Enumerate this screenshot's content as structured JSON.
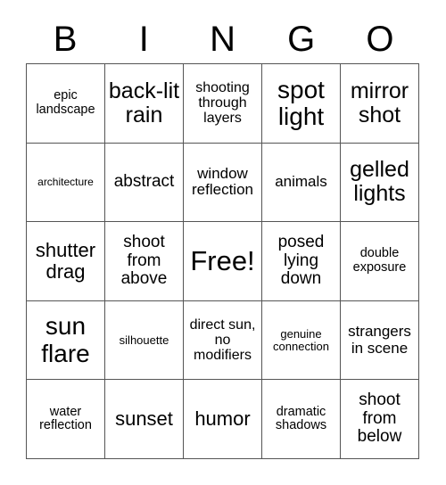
{
  "header": {
    "letters": [
      "B",
      "I",
      "N",
      "G",
      "O"
    ]
  },
  "grid": {
    "rows": [
      [
        {
          "text": "epic landscape",
          "size": "fs-s"
        },
        {
          "text": "back-lit rain",
          "size": "fs-xxl"
        },
        {
          "text": "shooting through layers",
          "size": "fs-m"
        },
        {
          "text": "spot light",
          "size": "fs-xxxl"
        },
        {
          "text": "mirror shot",
          "size": "fs-xxl"
        }
      ],
      [
        {
          "text": "architecture",
          "size": "fs-xxs"
        },
        {
          "text": "abstract",
          "size": "fs-l"
        },
        {
          "text": "window reflection",
          "size": "fs-ml"
        },
        {
          "text": "animals",
          "size": "fs-ml"
        },
        {
          "text": "gelled lights",
          "size": "fs-xxl"
        }
      ],
      [
        {
          "text": "shutter drag",
          "size": "fs-xl"
        },
        {
          "text": "shoot from above",
          "size": "fs-l"
        },
        {
          "text": "Free!",
          "size": "fs-huge"
        },
        {
          "text": "posed lying down",
          "size": "fs-l"
        },
        {
          "text": "double exposure",
          "size": "fs-s"
        }
      ],
      [
        {
          "text": "sun flare",
          "size": "fs-xxxl"
        },
        {
          "text": "silhouette",
          "size": "fs-xs"
        },
        {
          "text": "direct sun, no modifiers",
          "size": "fs-m"
        },
        {
          "text": "genuine connection",
          "size": "fs-xs"
        },
        {
          "text": "strangers in scene",
          "size": "fs-ml"
        }
      ],
      [
        {
          "text": "water reflection",
          "size": "fs-s"
        },
        {
          "text": "sunset",
          "size": "fs-xl"
        },
        {
          "text": "humor",
          "size": "fs-xl"
        },
        {
          "text": "dramatic shadows",
          "size": "fs-s"
        },
        {
          "text": "shoot from below",
          "size": "fs-l"
        }
      ]
    ]
  },
  "style": {
    "background_color": "#ffffff",
    "text_color": "#000000",
    "border_color": "#555555"
  }
}
